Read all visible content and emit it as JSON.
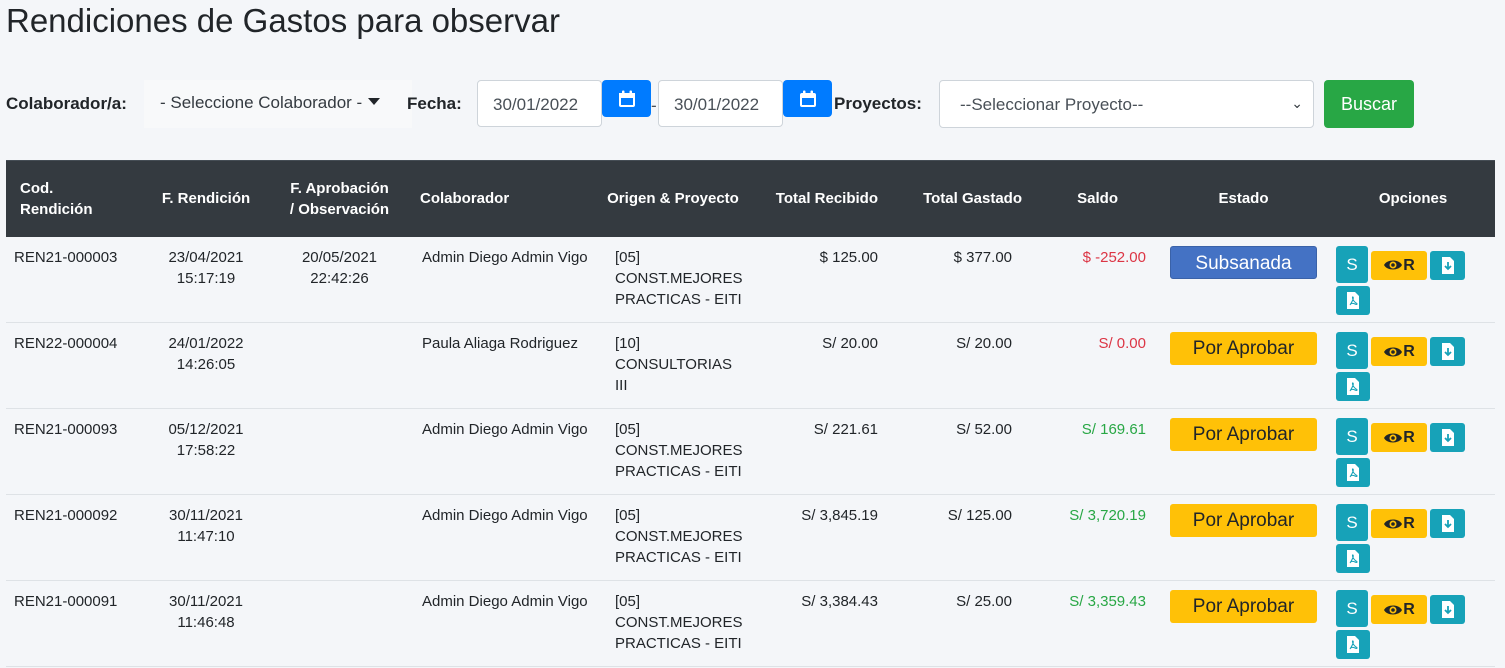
{
  "page": {
    "title": "Rendiciones de Gastos para observar"
  },
  "filters": {
    "colaborador_label": "Colaborador/a:",
    "colaborador_value": "- Seleccione Colaborador -",
    "fecha_label": "Fecha:",
    "fecha_desde": "30/01/2022",
    "fecha_separator": "-",
    "fecha_hasta": "30/01/2022",
    "proyectos_label": "Proyectos:",
    "proyecto_value": "--Seleccionar Proyecto--",
    "buscar_label": "Buscar"
  },
  "table": {
    "headers": {
      "cod_1": "Cod.",
      "cod_2": "Rendición",
      "f_rendicion": "F. Rendición",
      "f_aprob_1": "F. Aprobación",
      "f_aprob_2": "/ Observación",
      "colaborador": "Colaborador",
      "origen": "Origen & Proyecto",
      "total_recibido": "Total Recibido",
      "total_gastado": "Total Gastado",
      "saldo": "Saldo",
      "estado": "Estado",
      "opciones": "Opciones"
    },
    "rows": [
      {
        "cod": "REN21-000003",
        "f_rend_date": "23/04/2021",
        "f_rend_time": "15:17:19",
        "f_aprob_date": "20/05/2021",
        "f_aprob_time": "22:42:26",
        "colaborador": "Admin Diego Admin Vigo",
        "origen_1": "[05] CONST.MEJORES",
        "origen_2": "PRACTICAS - EITI",
        "recibido": "$ 125.00",
        "gastado": "$ 377.00",
        "saldo": "$ -252.00",
        "estado": "Subsanada"
      },
      {
        "cod": "REN22-000004",
        "f_rend_date": "24/01/2022",
        "f_rend_time": "14:26:05",
        "f_aprob_date": "",
        "f_aprob_time": "",
        "colaborador": "Paula Aliaga Rodriguez",
        "origen_1": "[10] CONSULTORIAS",
        "origen_2": "III",
        "recibido": "S/ 20.00",
        "gastado": "S/ 20.00",
        "saldo": "S/ 0.00",
        "estado": "Por Aprobar"
      },
      {
        "cod": "REN21-000093",
        "f_rend_date": "05/12/2021",
        "f_rend_time": "17:58:22",
        "f_aprob_date": "",
        "f_aprob_time": "",
        "colaborador": "Admin Diego Admin Vigo",
        "origen_1": "[05] CONST.MEJORES",
        "origen_2": "PRACTICAS - EITI",
        "recibido": "S/ 221.61",
        "gastado": "S/ 52.00",
        "saldo": "S/ 169.61",
        "estado": "Por Aprobar"
      },
      {
        "cod": "REN21-000092",
        "f_rend_date": "30/11/2021",
        "f_rend_time": "11:47:10",
        "f_aprob_date": "",
        "f_aprob_time": "",
        "colaborador": "Admin Diego Admin Vigo",
        "origen_1": "[05] CONST.MEJORES",
        "origen_2": "PRACTICAS - EITI",
        "recibido": "S/ 3,845.19",
        "gastado": "S/ 125.00",
        "saldo": "S/ 3,720.19",
        "estado": "Por Aprobar"
      },
      {
        "cod": "REN21-000091",
        "f_rend_date": "30/11/2021",
        "f_rend_time": "11:46:48",
        "f_aprob_date": "",
        "f_aprob_time": "",
        "colaborador": "Admin Diego Admin Vigo",
        "origen_1": "[05] CONST.MEJORES",
        "origen_2": "PRACTICAS - EITI",
        "recibido": "S/ 3,384.43",
        "gastado": "S/ 25.00",
        "saldo": "S/ 3,359.43",
        "estado": "Por Aprobar"
      }
    ],
    "option_labels": {
      "s": "S",
      "eye_suffix": "R"
    }
  },
  "colors": {
    "header_bg": "#343a40",
    "primary": "#007bff",
    "success": "#28a745",
    "info": "#17a2b8",
    "warning": "#ffc107",
    "danger": "#dc3545",
    "subsanada": "#4472c4"
  },
  "icons": [
    "calendar-icon",
    "chevron-down-icon",
    "eye-icon",
    "download-icon",
    "pdf-icon"
  ]
}
